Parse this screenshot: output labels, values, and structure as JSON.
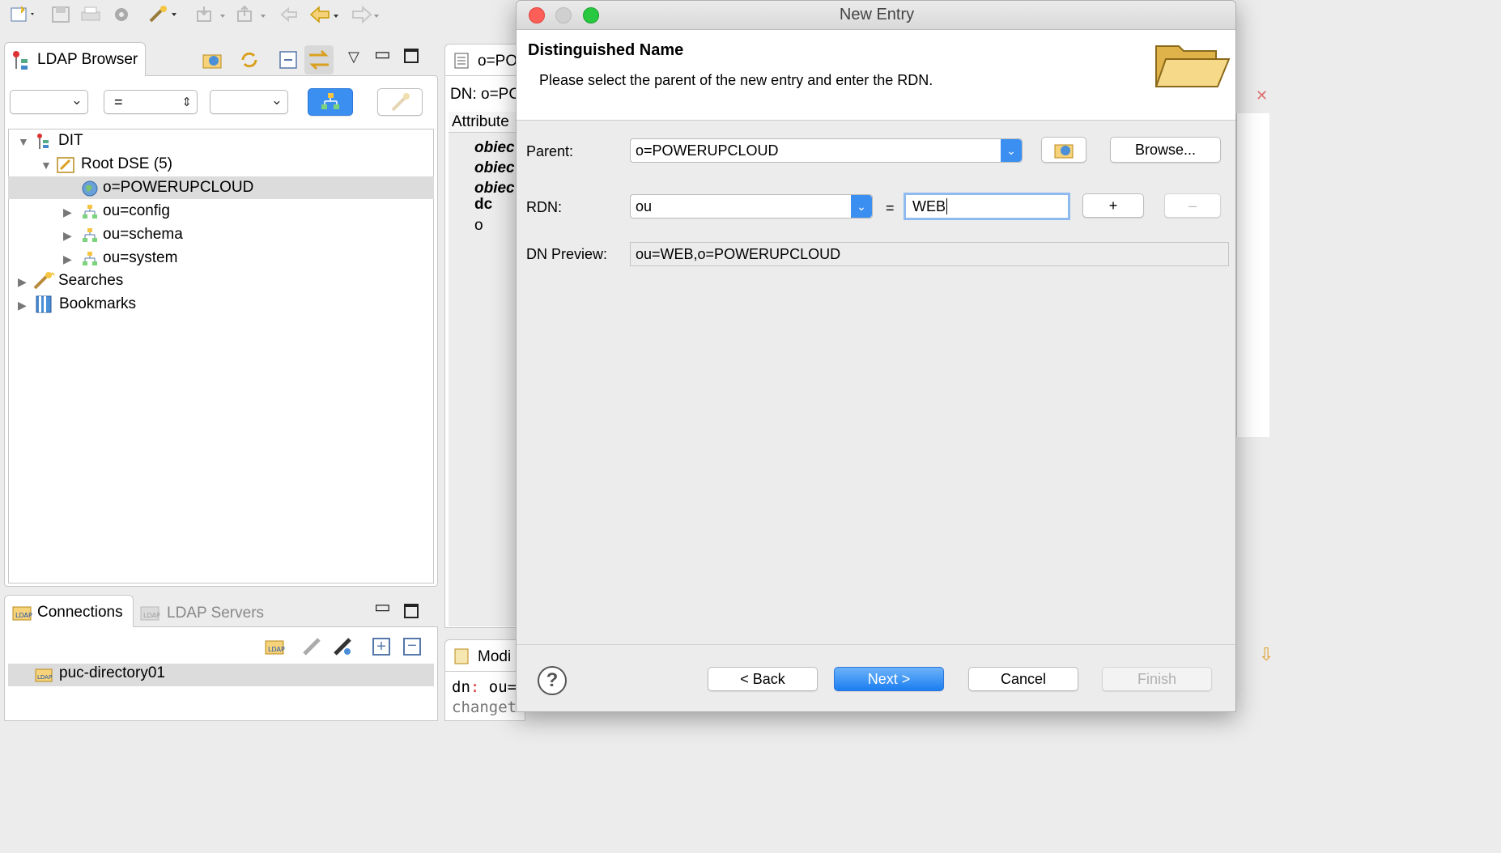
{
  "toolbar": {
    "icons": [
      "new-icon",
      "save-icon",
      "print-icon",
      "gear-icon",
      "search-wand-icon",
      "import-icon",
      "export-icon",
      "undo-icon",
      "back-icon",
      "forward-icon"
    ]
  },
  "ldap_browser": {
    "tab_label": "LDAP Browser",
    "filter_combo_1": "",
    "filter_combo_2": "=",
    "filter_combo_3": "",
    "tree": [
      {
        "label": "DIT",
        "level": 0,
        "expanded": true,
        "icon": "dit-icon"
      },
      {
        "label": "Root DSE (5)",
        "level": 1,
        "expanded": true,
        "icon": "root-dse-icon"
      },
      {
        "label": "o=POWERUPCLOUD",
        "level": 2,
        "selected": true,
        "icon": "globe-icon"
      },
      {
        "label": "ou=config",
        "level": 2,
        "icon": "org-unit-icon"
      },
      {
        "label": "ou=schema",
        "level": 2,
        "icon": "org-unit-icon"
      },
      {
        "label": "ou=system",
        "level": 2,
        "icon": "org-unit-icon"
      },
      {
        "label": "Searches",
        "level": 0,
        "icon": "searches-icon"
      },
      {
        "label": "Bookmarks",
        "level": 0,
        "icon": "bookmarks-icon"
      }
    ]
  },
  "connections": {
    "tab_label": "Connections",
    "tab2_label": "LDAP Servers",
    "items": [
      "puc-directory01"
    ]
  },
  "editor": {
    "tab_label": "o=PO",
    "dn_label": "DN: o=PC",
    "attr_header": "Attribute",
    "attrs": [
      "obiec",
      "obiec",
      "obiec",
      "dc",
      "o"
    ],
    "modif_tab": "Modi",
    "ldif_line1_key": "dn",
    "ldif_line1_sep": ":",
    "ldif_line1_val": "ou=",
    "ldif_line2": "changet"
  },
  "dialog": {
    "title": "New Entry",
    "heading": "Distinguished Name",
    "description": "Please select the parent of the new entry and enter the RDN.",
    "parent_label": "Parent:",
    "parent_value": "o=POWERUPCLOUD",
    "browse_label": "Browse...",
    "rdn_label": "RDN:",
    "rdn_type": "ou",
    "equals": "=",
    "rdn_value": "WEB",
    "plus_label": "+",
    "minus_label": "–",
    "dn_preview_label": "DN Preview:",
    "dn_preview_value": "ou=WEB,o=POWERUPCLOUD",
    "help_label": "?",
    "back_label": "< Back",
    "next_label": "Next >",
    "cancel_label": "Cancel",
    "finish_label": "Finish"
  },
  "colors": {
    "accent": "#3b8ff0",
    "selected_row": "#dcdcdc",
    "close": "#fc5f57",
    "minimize": "#fdbc2e",
    "zoom": "#28c840"
  }
}
